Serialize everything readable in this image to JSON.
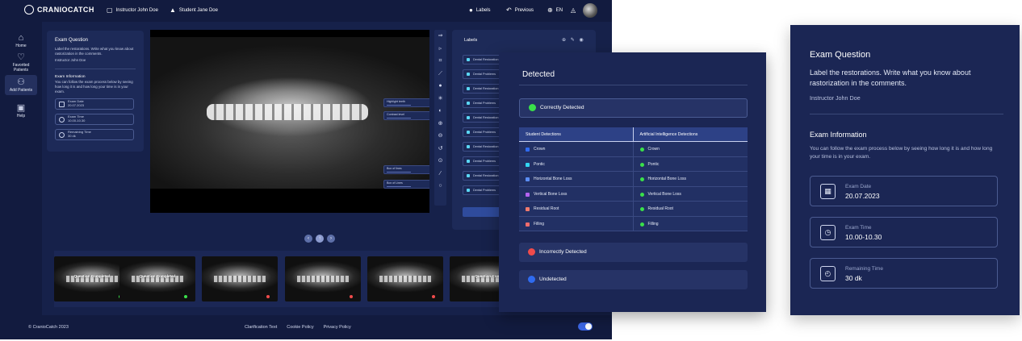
{
  "app": {
    "logo": "CRANIOCATCH",
    "top_instructor": "Instructor John Doe",
    "top_student": "Student Jane Doe",
    "top_labels": "Labels",
    "top_previous": "Previous",
    "top_lang": "EN"
  },
  "sidebar": {
    "items": [
      {
        "label": "Home",
        "icon": "home-icon"
      },
      {
        "label": "Favorited Patients",
        "icon": "heart-icon"
      },
      {
        "label": "Add Patients",
        "icon": "add-patient-icon"
      },
      {
        "label": "Help",
        "icon": "help-icon"
      }
    ]
  },
  "exam_small": {
    "title": "Exam Question",
    "desc": "Label the restorations. Write what you know about rastorization in the comments.",
    "instructor": "Instructor John Doe",
    "info_title": "Exam Information",
    "info_desc": "You can follow the exam process below by seeing how long it is and how long your time is in your exam.",
    "fields": [
      {
        "label": "Exam Date",
        "value": "20.07.2023"
      },
      {
        "label": "Exam Time",
        "value": "10.00-10.30"
      },
      {
        "label": "Remaining Time",
        "value": "30 dk"
      }
    ]
  },
  "xray_tools": {
    "highlight": "Highlight teeth",
    "contrast": "Contrast level",
    "box": "Box of lines",
    "box2": "Box of Lines"
  },
  "labels_panel": {
    "title": "Labels",
    "rows": [
      "Dental Restoration",
      "Dental Problems",
      "Dental Restoration",
      "Dental Problems",
      "Dental Restoration",
      "Dental Problems",
      "Dental Restoration",
      "Dental Problems",
      "Dental Restoration",
      "Dental Problems"
    ]
  },
  "thumbs": [
    {
      "caption": "Question Completed",
      "status": "#3ae04a"
    },
    {
      "caption": "Question Completed",
      "status": "#3ae04a"
    },
    {
      "caption": "",
      "status": "#f04b4b"
    },
    {
      "caption": "",
      "status": "#f04b4b"
    },
    {
      "caption": "",
      "status": "#f04b4b"
    },
    {
      "caption": "Question Com",
      "status": "#f04b4b"
    }
  ],
  "footer": {
    "copyright": "© CranioCatch 2023",
    "clarification": "Clarification Text",
    "cookie": "Cookie Policy",
    "privacy": "Privacy Policy"
  },
  "detected": {
    "title": "Detected",
    "correct": "Correctly Detected",
    "incorrect": "Incorrectly Detected",
    "undetected": "Undetected",
    "col_student": "Student Detections",
    "col_ai": "Artificial Intelligence Detections",
    "rows": [
      {
        "student": "Crown",
        "ai": "Crown",
        "color": "#2f6bf0"
      },
      {
        "student": "Pontic",
        "ai": "Pontic",
        "color": "#33d6f2"
      },
      {
        "student": "Horizontal Bone Loss",
        "ai": "Horizontal Bone Loss",
        "color": "#5b8ef5"
      },
      {
        "student": "Vertical Bone Loss",
        "ai": "Vertical Bone Loss",
        "color": "#b463f0"
      },
      {
        "student": "Residual Root",
        "ai": "Residual Root",
        "color": "#f07a6e"
      },
      {
        "student": "Filling",
        "ai": "Filling",
        "color": "#f06c6c"
      }
    ],
    "colors": {
      "correct": "#3ae04a",
      "incorrect": "#f04b4b",
      "undetected": "#2f6bf0"
    }
  },
  "exam_big": {
    "title": "Exam Question",
    "desc": "Label the restorations. Write what you know about rastorization in the comments.",
    "instructor": "Instructor John Doe",
    "info_title": "Exam Information",
    "info_desc": "You can follow the exam process below by seeing how long it is and how long your time is in your exam.",
    "fields": [
      {
        "label": "Exam Date",
        "value": "20.07.2023",
        "icon": "calendar-icon"
      },
      {
        "label": "Exam Time",
        "value": "10.00-10.30",
        "icon": "clock-icon"
      },
      {
        "label": "Remaining Time",
        "value": "30 dk",
        "icon": "timer-icon"
      }
    ]
  }
}
